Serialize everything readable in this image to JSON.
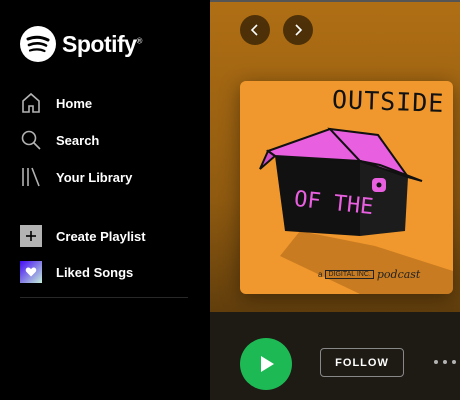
{
  "app": {
    "name": "Spotify"
  },
  "sidebar": {
    "items": [
      {
        "label": "Home",
        "icon": "home-icon"
      },
      {
        "label": "Search",
        "icon": "search-icon"
      },
      {
        "label": "Your Library",
        "icon": "library-icon"
      }
    ],
    "actions": [
      {
        "label": "Create Playlist",
        "icon": "plus-icon"
      },
      {
        "label": "Liked Songs",
        "icon": "heart-icon"
      }
    ]
  },
  "podcast": {
    "cover_text_top": "OUTSIDE",
    "cover_text_mid": "OF THE",
    "cover_sub_prefix": "a",
    "cover_sub_brand": "DIGITAL INC.",
    "cover_sub_suffix": "podcast"
  },
  "actions": {
    "follow_label": "FOLLOW"
  },
  "colors": {
    "accent": "#1db954",
    "cover_bg": "#f0982d",
    "cover_pink": "#e85fe0"
  }
}
